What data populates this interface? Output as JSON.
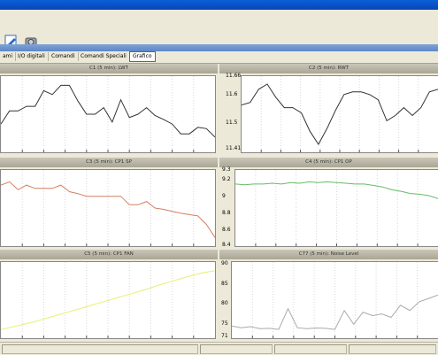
{
  "toolbar": {
    "icons": [
      "edit-icon",
      "tools-icon"
    ]
  },
  "tabs": [
    {
      "label": "ami"
    },
    {
      "label": "I/O digitali"
    },
    {
      "label": "Comandi"
    },
    {
      "label": "Comandi Speciali"
    },
    {
      "label": "Grafico",
      "active": true
    }
  ],
  "panels": [
    {
      "title": "C1 (5 min): LWT",
      "ticks": []
    },
    {
      "title": "C2 (5 min): RWT",
      "ticks": [
        "11.66",
        "11.6",
        "11.5",
        "11.41"
      ]
    },
    {
      "title": "C3 (5 min): CP1 SP",
      "ticks": []
    },
    {
      "title": "C4 (5 min): CP1 OP",
      "ticks": [
        "9.3",
        "9.2",
        "9",
        "8.8",
        "8.6",
        "8.4"
      ]
    },
    {
      "title": "C5 (5 min): CP1 FAN",
      "ticks": []
    },
    {
      "title": "C77 (5 min): Noise Level",
      "ticks": [
        "90",
        "85",
        "80",
        "75",
        "71"
      ]
    }
  ],
  "chart_data": [
    {
      "type": "line",
      "title": "C1 (5 min): LWT",
      "color": "#333333",
      "y": [
        0.35,
        0.55,
        0.55,
        0.62,
        0.62,
        0.86,
        0.8,
        0.94,
        0.94,
        0.7,
        0.5,
        0.5,
        0.6,
        0.38,
        0.72,
        0.45,
        0.5,
        0.6,
        0.48,
        0.42,
        0.35,
        0.2,
        0.2,
        0.3,
        0.28,
        0.15
      ],
      "ylim": [
        0,
        1
      ]
    },
    {
      "type": "line",
      "title": "C2 (5 min): RWT",
      "color": "#333333",
      "y": [
        11.57,
        11.58,
        11.63,
        11.65,
        11.6,
        11.56,
        11.56,
        11.54,
        11.47,
        11.42,
        11.48,
        11.55,
        11.61,
        11.62,
        11.62,
        11.61,
        11.59,
        11.51,
        11.53,
        11.56,
        11.53,
        11.56,
        11.62,
        11.63
      ],
      "ylim": [
        11.41,
        11.66
      ]
    },
    {
      "type": "line",
      "title": "C3 (5 min): CP1 SP",
      "color": "#d08060",
      "y": [
        0.85,
        0.9,
        0.78,
        0.85,
        0.8,
        0.8,
        0.8,
        0.85,
        0.75,
        0.72,
        0.68,
        0.68,
        0.68,
        0.68,
        0.68,
        0.55,
        0.55,
        0.6,
        0.5,
        0.48,
        0.45,
        0.42,
        0.4,
        0.38,
        0.25,
        0.05
      ],
      "ylim": [
        0,
        1
      ]
    },
    {
      "type": "line",
      "title": "C4 (5 min): CP1 OP",
      "color": "#66bb66",
      "y": [
        9.18,
        9.17,
        9.18,
        9.18,
        9.19,
        9.18,
        9.2,
        9.19,
        9.21,
        9.2,
        9.21,
        9.2,
        9.19,
        9.18,
        9.18,
        9.16,
        9.14,
        9.1,
        9.08,
        9.05,
        9.04,
        9.02,
        8.98
      ],
      "ylim": [
        8.4,
        9.3
      ]
    },
    {
      "type": "line",
      "title": "C5 (5 min): CP1 FAN",
      "color": "#e8ef70",
      "y": [
        0.05,
        0.09,
        0.13,
        0.17,
        0.22,
        0.27,
        0.32,
        0.37,
        0.42,
        0.47,
        0.52,
        0.57,
        0.62,
        0.67,
        0.73,
        0.78,
        0.83,
        0.88,
        0.92,
        0.95
      ],
      "ylim": [
        0,
        1
      ]
    },
    {
      "type": "line",
      "title": "C77 (5 min): Noise Level",
      "color": "#aaaaaa",
      "y": [
        73,
        72.5,
        72.8,
        72.2,
        72.3,
        72.0,
        78.0,
        72.5,
        72.2,
        72.4,
        72.3,
        72.0,
        77.5,
        73.5,
        77.0,
        76.0,
        76.5,
        75.5,
        79,
        77.5,
        80,
        81,
        82
      ],
      "ylim": [
        71,
        90
      ]
    }
  ]
}
